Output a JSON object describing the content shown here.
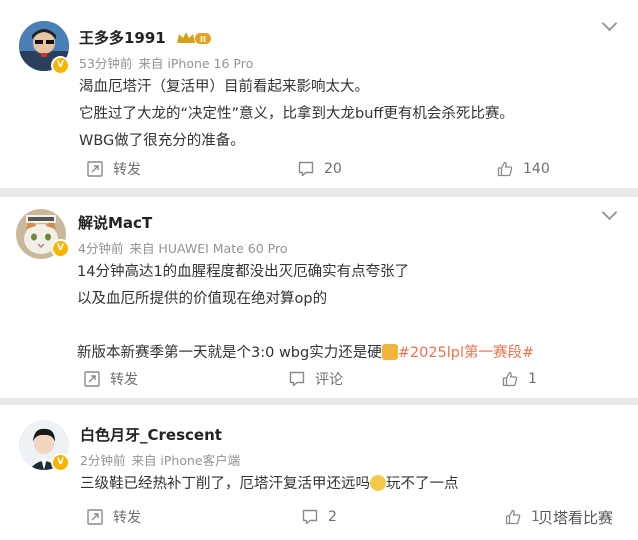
{
  "comments": [
    {
      "user": "王多多1991",
      "time": "53分钟前",
      "source": "来自 iPhone 16 Pro",
      "lines": [
        "渴血厄塔汗（复活甲）目前看起来影响太大。",
        "它胜过了大龙的“决定性”意义，比拿到大龙buff更有机会杀死比赛。",
        "WBG做了很充分的准备。"
      ],
      "forward_label": "转发",
      "comment_count": "20",
      "like_count": "140"
    },
    {
      "user": "解说MacT",
      "time": "4分钟前",
      "source": "来自 HUAWEI Mate 60 Pro",
      "lines": [
        "14分钟高达1的血腥程度都没出灭厄确实有点夸张了",
        "以及血厄所提供的价值现在绝对算op的",
        "",
        "新版本新赛季第一天就是个3:0 wbg实力还是硬"
      ],
      "hashtag": "#2025lpl第一赛段#",
      "forward_label": "转发",
      "comment_label": "评论",
      "like_count": "1"
    },
    {
      "user": "白色月牙_Crescent",
      "time": "2分钟前",
      "source": "来自 iPhone客户端",
      "text_before_emoji": "三级鞋已经热补丁削了，厄塔汗复活甲还远吗",
      "text_after_emoji": "玩不了一点",
      "forward_label": "转发",
      "comment_count": "2",
      "like_count": "1"
    }
  ],
  "watermark": "贝塔看比赛",
  "colors": {
    "background": "#e9e9e9",
    "hashtag": "#eb7350",
    "muted": "#939393",
    "verified_badge": "#f7b500"
  },
  "icons": {
    "forward": "share-icon",
    "comment": "comment-icon",
    "like": "thumbs-up-icon",
    "more": "chevron-down-icon",
    "verified": "verified-badge-icon",
    "member": "crown-badge-icon"
  }
}
